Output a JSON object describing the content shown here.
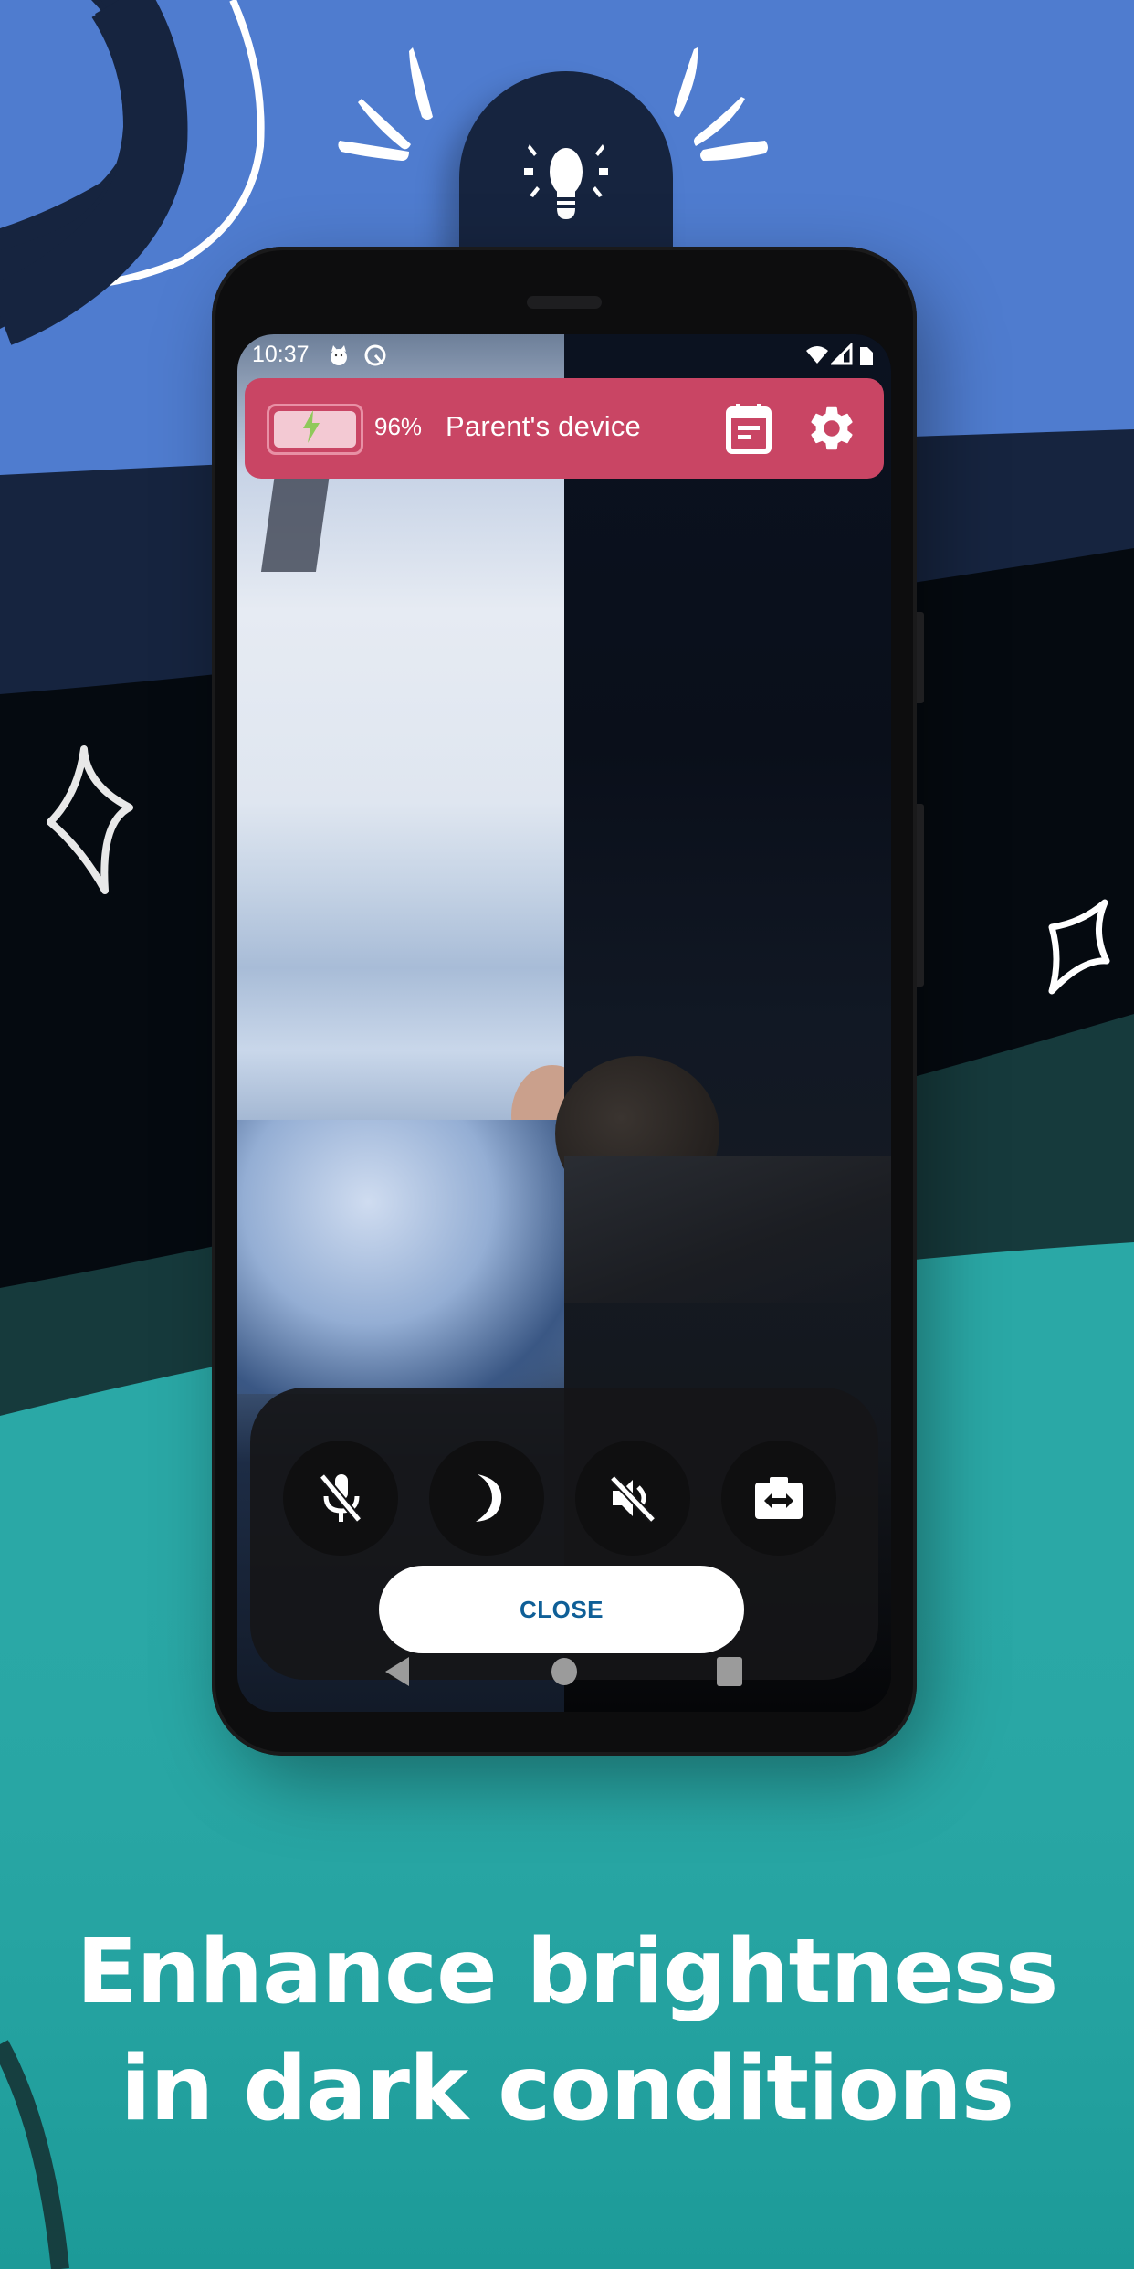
{
  "background": {
    "colors": {
      "top_blue": "#4f7ccf",
      "navy_band": "#16243f",
      "night_band": "#050a10",
      "deep_teal_band": "#163a3c",
      "teal": "#22a09e",
      "lamp_tab": "#16243f"
    },
    "decorations": [
      "lightbulb-icon",
      "sparkle-star-left",
      "sparkle-star-right",
      "curved-line-top-left",
      "curved-line-bottom-left"
    ]
  },
  "status_bar": {
    "time": "10:37",
    "left_icons": [
      "cat-app-icon",
      "android-q-icon"
    ],
    "right_icons": [
      "wifi-icon",
      "cell-signal-icon",
      "battery-status-icon"
    ]
  },
  "top_bar": {
    "color": "#c94564",
    "battery_percent": "96%",
    "battery_charging": true,
    "device_name": "Parent's device",
    "buttons": [
      "calendar-icon",
      "settings-gear-icon"
    ]
  },
  "controls": {
    "buttons": [
      {
        "name": "microphone-muted",
        "icon": "mic-off-icon"
      },
      {
        "name": "night-mode",
        "icon": "moon-icon"
      },
      {
        "name": "speaker-muted",
        "icon": "volume-off-icon"
      },
      {
        "name": "switch-camera",
        "icon": "camera-switch-icon"
      }
    ],
    "close_label": "CLOSE",
    "close_color": "#0f5f97"
  },
  "nav_bar": {
    "buttons": [
      "back",
      "home",
      "recents"
    ]
  },
  "headline": {
    "line1": "Enhance brightness",
    "line2": "in dark conditions"
  }
}
